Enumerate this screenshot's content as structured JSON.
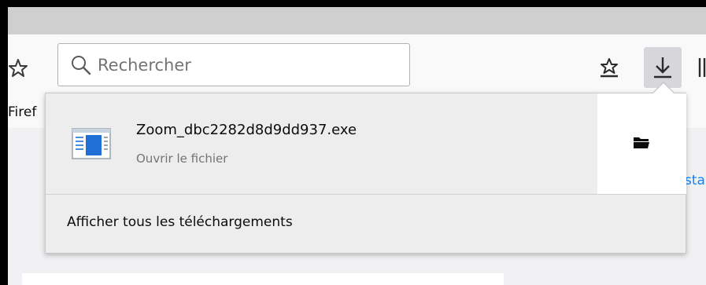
{
  "search": {
    "placeholder": "Rechercher"
  },
  "bookmarks_bar": {
    "partial_label": "Firef"
  },
  "page": {
    "partial_link": "sta"
  },
  "downloads_panel": {
    "item": {
      "file_name": "Zoom_dbc2282d8d9dd937.exe",
      "status": "Ouvrir le fichier"
    },
    "show_all_label": "Afficher tous les téléchargements"
  },
  "icons": {
    "bookmark_star": "star-icon",
    "search": "search-icon",
    "bookmarks_menu": "star-tray-icon",
    "downloads": "download-arrow-icon",
    "library": "library-icon",
    "file": "executable-file-icon",
    "folder": "folder-icon"
  },
  "colors": {
    "panel_bg": "#ededed",
    "active_button_bg": "#d7d7db",
    "link": "#0a84ff"
  }
}
